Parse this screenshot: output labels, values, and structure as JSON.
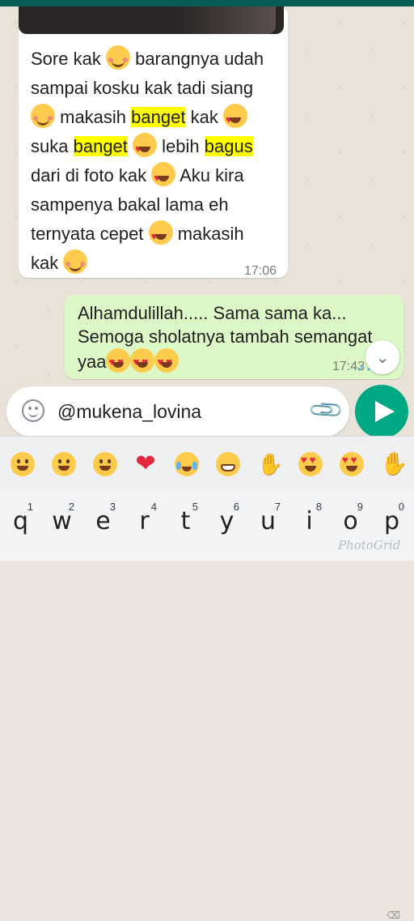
{
  "incoming": {
    "line1": "Sore kak",
    "line1b": "barangnya udah",
    "line2": "sampai kosku kak tadi siang",
    "line3a": "makasih",
    "line3hl": "banget",
    "line3b": "kak",
    "line4a": "suka",
    "line4hl": "banget",
    "line4b": "lebih",
    "line4hl2": "bagus",
    "line5a": "dari di foto kak",
    "line5b": "Aku kira",
    "line6": "sampenya bakal lama eh",
    "line7a": "ternyata cepet",
    "line7b": "makasih",
    "line8": "kak",
    "time": "17:06"
  },
  "outgoing": {
    "line1": "Alhamdulillah..... Sama sama ka...",
    "line2": "Semoga sholatnya tambah semangat",
    "line3": "yaa",
    "time": "17:43"
  },
  "composer": {
    "value": "@mukena_lovina"
  },
  "keyboard": {
    "keys": [
      {
        "hint": "1",
        "char": "q"
      },
      {
        "hint": "2",
        "char": "w"
      },
      {
        "hint": "3",
        "char": "e"
      },
      {
        "hint": "4",
        "char": "r"
      },
      {
        "hint": "5",
        "char": "t"
      },
      {
        "hint": "6",
        "char": "y"
      },
      {
        "hint": "7",
        "char": "u"
      },
      {
        "hint": "8",
        "char": "i"
      },
      {
        "hint": "9",
        "char": "o"
      },
      {
        "hint": "0",
        "char": "p"
      }
    ]
  },
  "watermark": "PhotoGrid",
  "colors": {
    "header": "#075e54",
    "outgoing_bubble": "#dcf8c6",
    "send_button": "#00a884",
    "highlight": "#ffff00"
  },
  "icons": {
    "emoji_bar": [
      "joy-icon",
      "kissing-heart-icon",
      "smile-icon",
      "red-heart-icon",
      "crying-icon",
      "grinning-icon",
      "pray-icon",
      "smiling-hearts-icon",
      "heart-eyes-icon",
      "thumbs-up-icon"
    ]
  }
}
